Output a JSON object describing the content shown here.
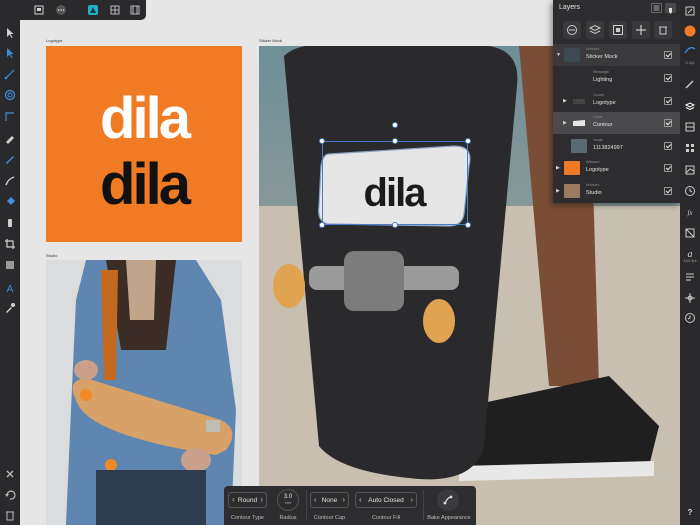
{
  "canvas": {
    "artboards": [
      {
        "label": "Logotype"
      },
      {
        "label": "Studio"
      },
      {
        "label": "Sticker Mock"
      }
    ],
    "logo_text": "dila"
  },
  "layers_panel": {
    "title": "Layers",
    "layers": [
      {
        "type": "Artboard",
        "name": "Sticker Mock",
        "expanded": true,
        "indent": 0
      },
      {
        "type": "Rectangle",
        "name": "Lighting",
        "indent": 1
      },
      {
        "type": "Curves",
        "name": "Logotype",
        "indent": 1
      },
      {
        "type": "Curve",
        "name": "Contour",
        "indent": 1,
        "selected": true
      },
      {
        "type": "Image",
        "name": "1113824997",
        "indent": 1
      },
      {
        "type": "Artboard",
        "name": "Logotype",
        "indent": 0
      },
      {
        "type": "Artboard",
        "name": "Studio",
        "indent": 0
      }
    ]
  },
  "right_toolbar": {
    "stroke_width": "0.2pt",
    "font_size": "144.4pt"
  },
  "context_toolbar": {
    "contour_type": {
      "value": "Round",
      "caption": "Contour Type"
    },
    "radius": {
      "value": "3.0",
      "unit": "mm",
      "caption": "Radius"
    },
    "contour_cap": {
      "value": "None",
      "caption": "Contour Cap"
    },
    "contour_fill": {
      "value": "Auto Closed",
      "caption": "Contour Fill"
    },
    "bake": {
      "caption": "Bake Appearance"
    }
  },
  "help_label": "?",
  "colors": {
    "accent_orange": "#f07b24",
    "panel_bg": "#2d2d2f",
    "toolbar_bg": "#2a2a2c",
    "canvas_bg": "#e6e6e6"
  }
}
